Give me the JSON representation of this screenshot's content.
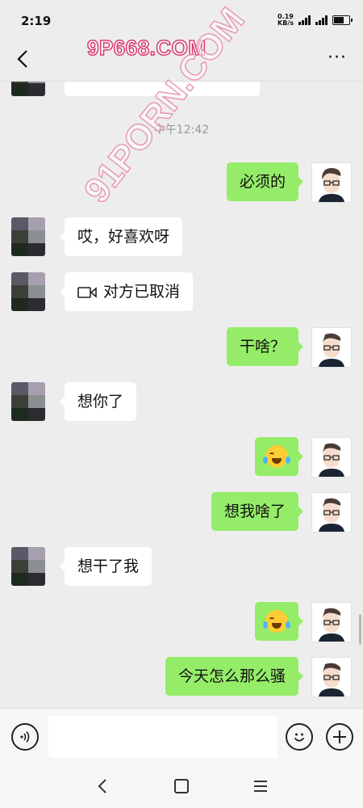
{
  "status": {
    "time": "2:19",
    "net_speed_value": "0.19",
    "net_speed_unit": "KB/s"
  },
  "nav": {
    "more_label": "···"
  },
  "watermarks": {
    "top": "9P668.COM",
    "diagonal": "91PORN.COM"
  },
  "chat": {
    "time_stamp": "中午12:42",
    "messages": [
      {
        "side": "me",
        "text": "必须的"
      },
      {
        "side": "peer",
        "text": "哎，好喜欢呀"
      },
      {
        "side": "peer",
        "text": "对方已取消",
        "type": "video-call"
      },
      {
        "side": "me",
        "text": "干啥？"
      },
      {
        "side": "peer",
        "text": "想你了"
      },
      {
        "side": "me",
        "type": "emoji",
        "icon": "laughing-crying-emoji"
      },
      {
        "side": "me",
        "text": "想我啥了"
      },
      {
        "side": "peer",
        "text": "想干了我"
      },
      {
        "side": "me",
        "type": "emoji",
        "icon": "laughing-crying-emoji"
      },
      {
        "side": "me",
        "text": "今天怎么那么骚"
      }
    ]
  },
  "input": {
    "placeholder": ""
  },
  "colors": {
    "my_bubble": "#95ec69",
    "peer_bubble": "#ffffff",
    "background": "#ededed"
  }
}
